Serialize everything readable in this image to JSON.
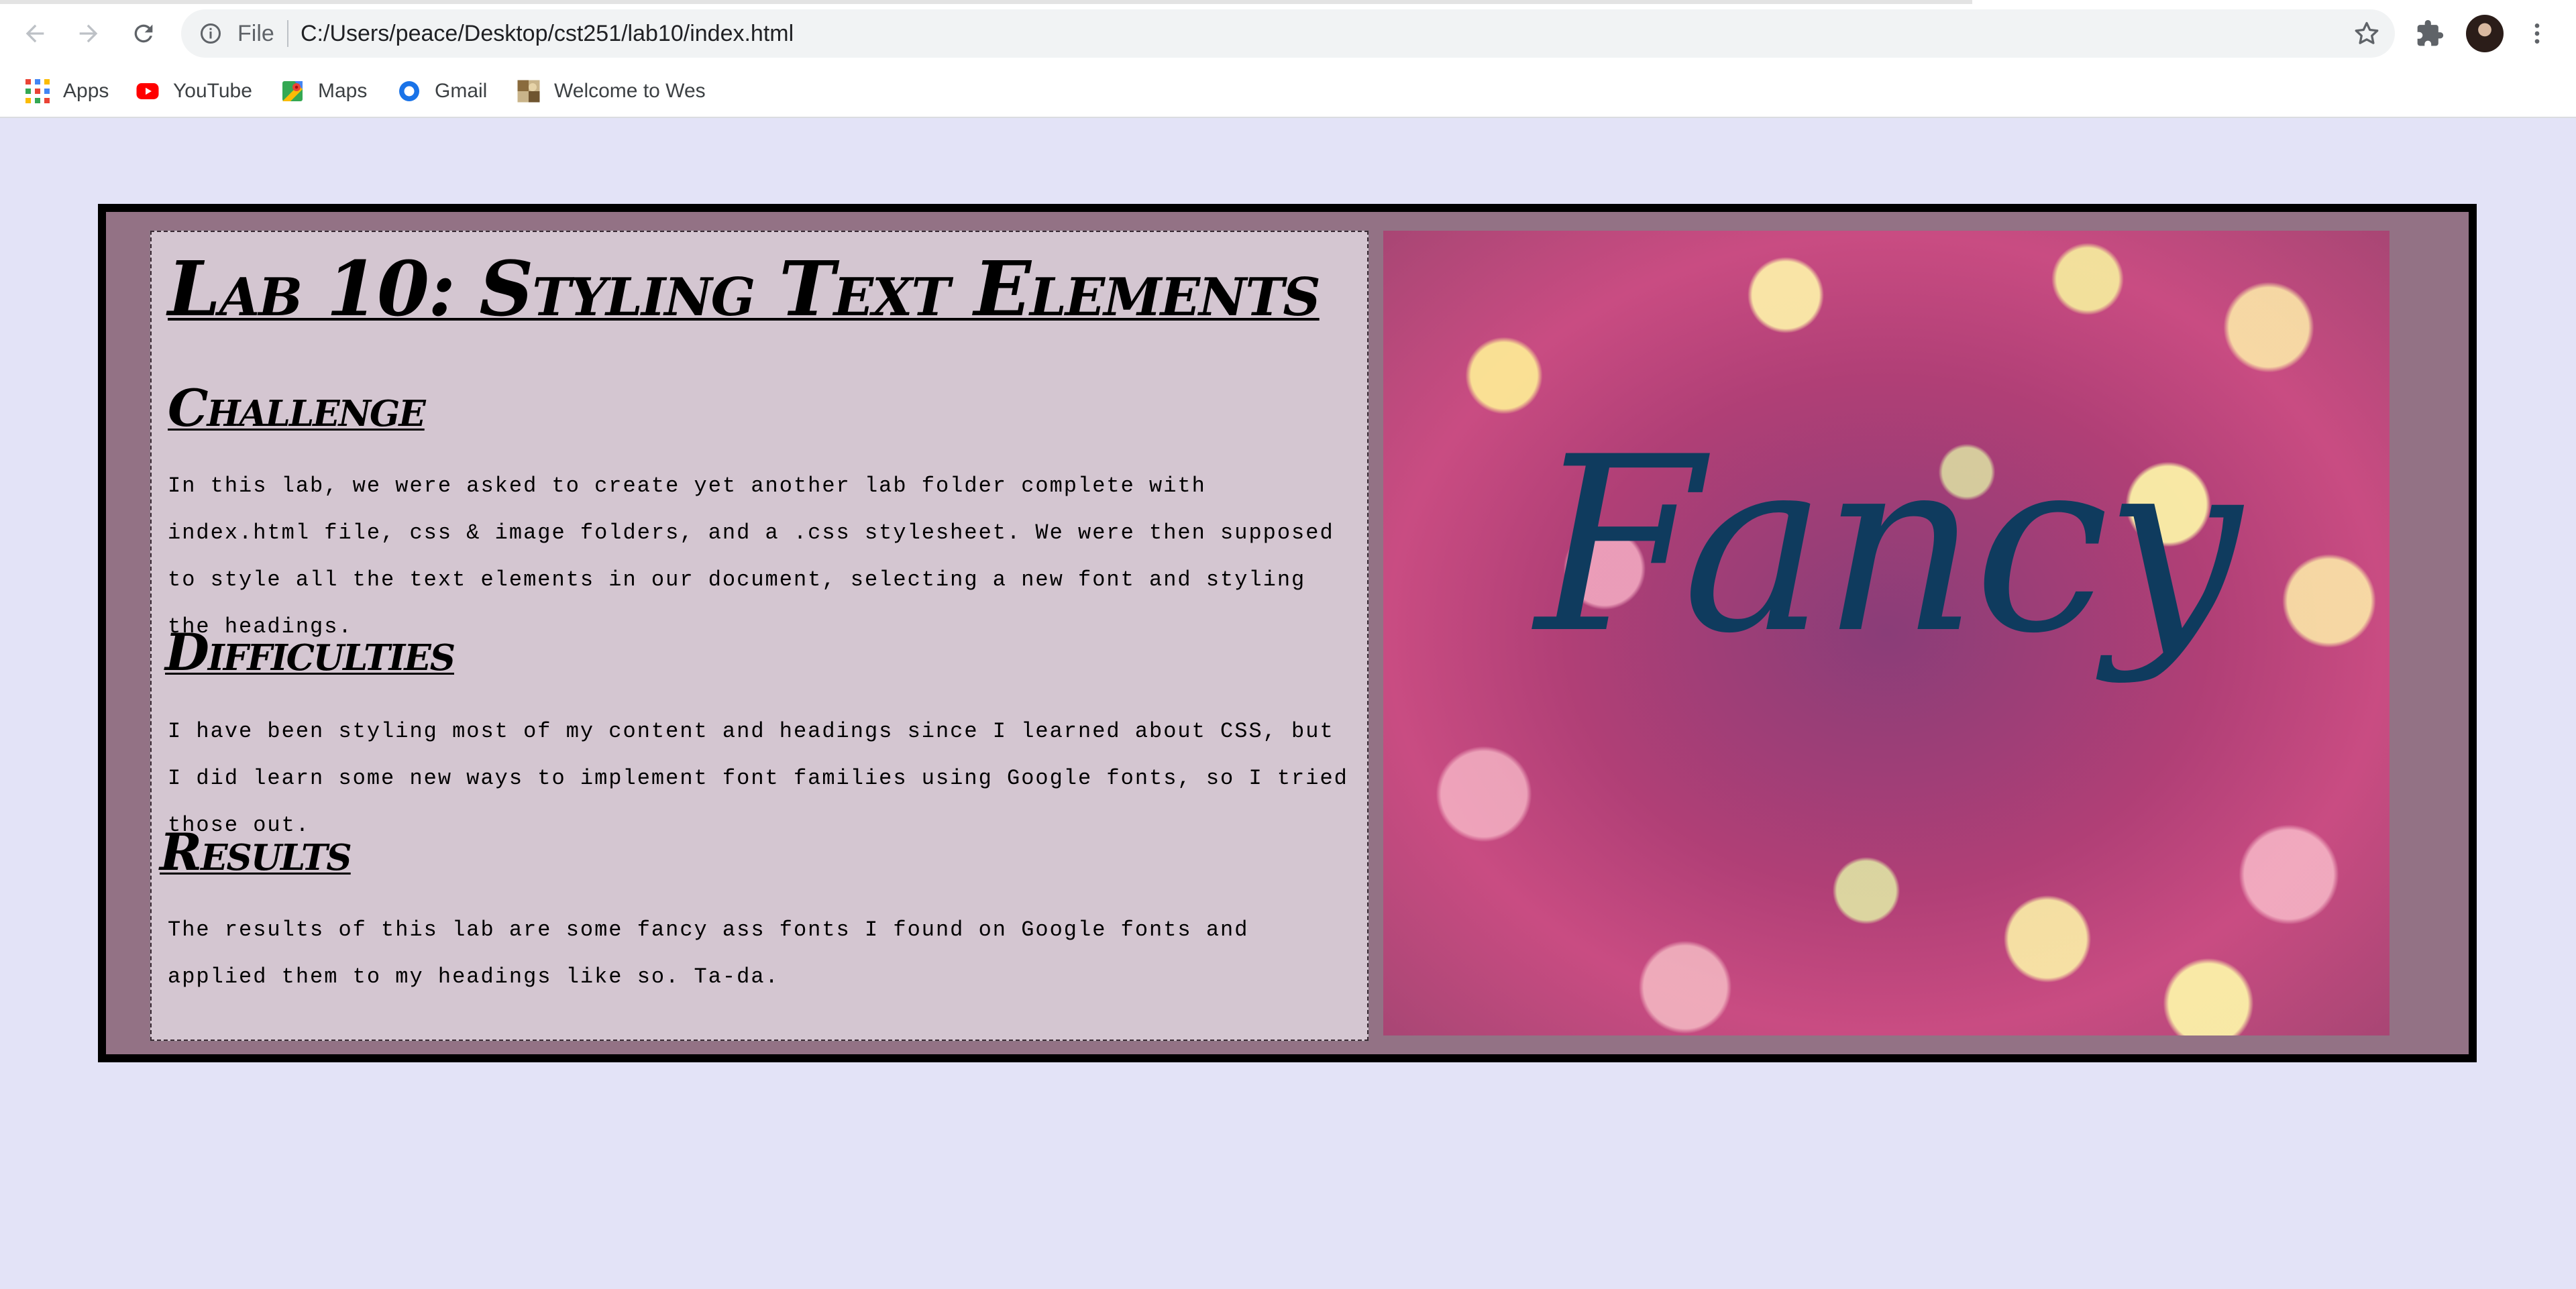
{
  "browser": {
    "url_scheme_label": "File",
    "url": "C:/Users/peace/Desktop/cst251/lab10/index.html"
  },
  "bookmarks": [
    {
      "label": "Apps",
      "icon": "apps-grid-icon"
    },
    {
      "label": "YouTube",
      "icon": "youtube-icon"
    },
    {
      "label": "Maps",
      "icon": "maps-icon"
    },
    {
      "label": "Gmail",
      "icon": "gmail-icon"
    },
    {
      "label": "Welcome to Wes",
      "icon": "site-favicon-icon"
    }
  ],
  "page": {
    "title": "Lab 10: Styling Text Elements",
    "sections": [
      {
        "heading": "Challenge",
        "text": "In this lab, we were asked to create yet another lab folder complete with index.html file, css & image folders, and a .css stylesheet. We were then supposed to style all the text elements in our document, selecting a new font and styling the headings."
      },
      {
        "heading": "Difficulties",
        "text": "I have been styling most of my content and headings since I learned about CSS, but I did learn some new ways to implement font families using Google fonts, so I tried those out."
      },
      {
        "heading": "Results",
        "text": "The results of this lab are some fancy ass fonts I found on Google fonts and applied them to my headings like so. Ta-da."
      }
    ],
    "image_word": "Fancy"
  },
  "colors": {
    "page_background": "#e3e3f7",
    "frame_background": "#937285",
    "text_panel_background": "#d4c6d1",
    "fancy_text": "#0f3b5e"
  }
}
